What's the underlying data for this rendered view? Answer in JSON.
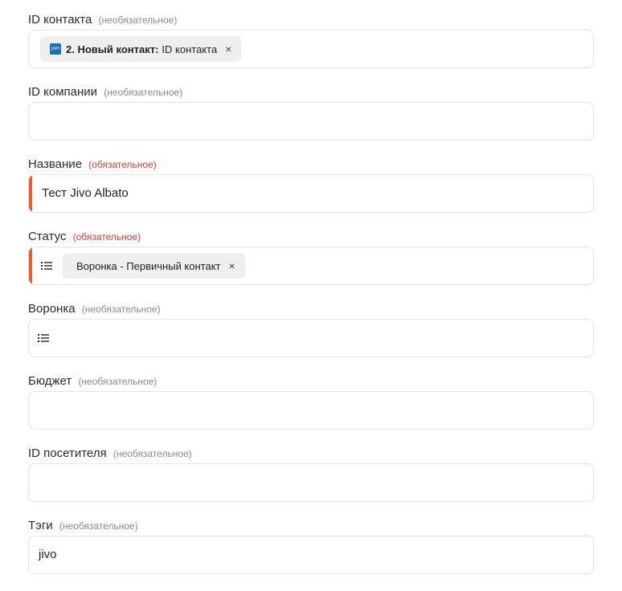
{
  "hints": {
    "optional": "(необязательное)",
    "required": "(обязательное)"
  },
  "fields": {
    "contact_id": {
      "label": "ID контакта",
      "chip": {
        "icon": "jivo-app-icon",
        "icon_text": "JIVO",
        "step": "2. Новый контакт:",
        "value": "ID контакта",
        "close": "×"
      }
    },
    "company_id": {
      "label": "ID компании",
      "value": ""
    },
    "name": {
      "label": "Название",
      "value": "Тест Jivo Albato"
    },
    "status": {
      "label": "Статус",
      "chip": {
        "value": "Воронка - Первичный контакт",
        "close": "×"
      }
    },
    "pipeline": {
      "label": "Воронка",
      "value": ""
    },
    "budget": {
      "label": "Бюджет",
      "value": ""
    },
    "visitor_id": {
      "label": "ID посетителя",
      "value": ""
    },
    "tags": {
      "label": "Тэги",
      "value": "jivo"
    }
  },
  "colors": {
    "required_accent": "#ef5a2a",
    "required_hint": "#e53935",
    "optional_hint": "#8a8a8a",
    "chip_bg": "#efefef",
    "border": "#e3e3e3"
  }
}
